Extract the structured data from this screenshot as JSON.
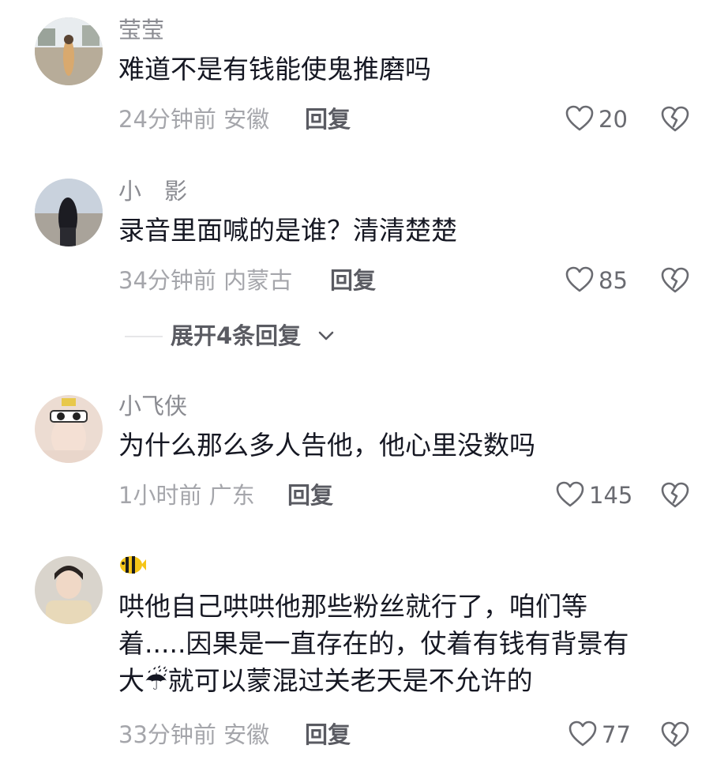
{
  "comments": [
    {
      "username": "莹莹",
      "lines": [
        "难道不是有钱能使鬼推磨吗"
      ],
      "time_location": "24分钟前 安徽",
      "reply_label": "回复",
      "likes": "20"
    },
    {
      "username": "小　影",
      "lines": [
        "录音里面喊的是谁？清清楚楚"
      ],
      "time_location": "34分钟前 内蒙古",
      "reply_label": "回复",
      "likes": "85",
      "expand_replies": "展开4条回复"
    },
    {
      "username": "小飞侠",
      "lines": [
        "为什么那么多人告他，他心里没数吗"
      ],
      "time_location": "1小时前 广东",
      "reply_label": "回复",
      "likes": "145"
    },
    {
      "username_icon": "tropical-fish-emoji",
      "lines": [
        "哄他自己哄哄他那些粉丝就行了，咱们等",
        "着.....因果是一直存在的，仗着有钱有背景有",
        "大☔就可以蒙混过关老天是不允许的"
      ],
      "time_location": "33分钟前 安徽",
      "reply_label": "回复",
      "likes": "77"
    }
  ],
  "icons": {
    "like": "heart-outline-icon",
    "dislike": "broken-heart-icon",
    "expand": "chevron-down-icon"
  },
  "colors": {
    "text": "#161823",
    "meta": "#a5a6ab",
    "username": "#8a8b91",
    "reply": "#5a5b62"
  }
}
